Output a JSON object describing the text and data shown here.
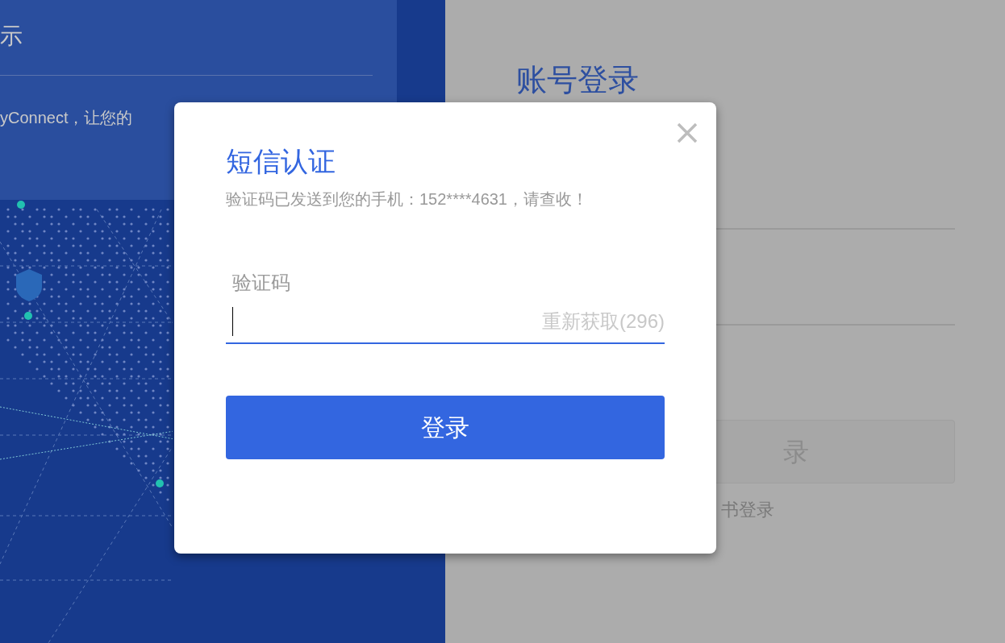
{
  "background_card": {
    "title": "示",
    "text": "yConnect，让您的"
  },
  "login_panel": {
    "title": "账号登录",
    "button": "录",
    "link": "书登录"
  },
  "dialog": {
    "title": "短信认证",
    "message": "验证码已发送到您的手机：152****4631，请查收！",
    "code_field": {
      "label": "验证码",
      "focused": true
    },
    "resend": "重新获取(296)",
    "submit": "登录"
  }
}
